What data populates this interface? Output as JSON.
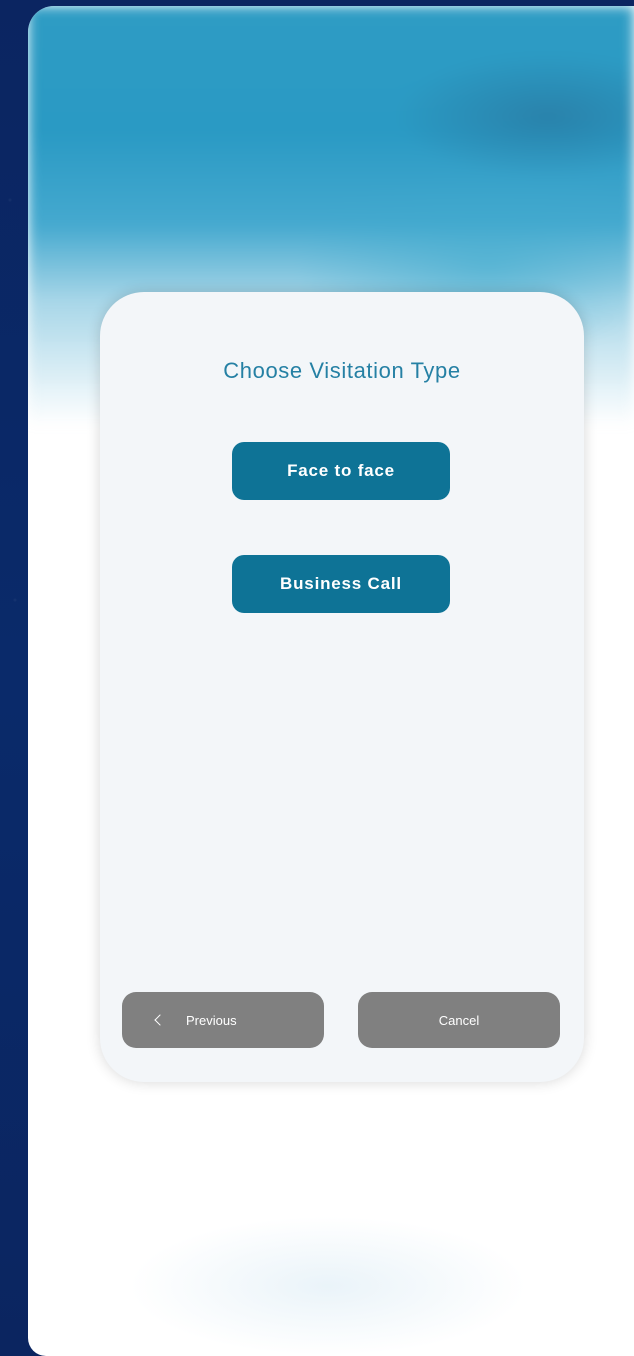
{
  "dialog": {
    "title": "Choose Visitation Type",
    "options": [
      {
        "label": "Face to face"
      },
      {
        "label": "Business Call"
      }
    ],
    "footer": {
      "previous_label": "Previous",
      "cancel_label": "Cancel"
    }
  },
  "colors": {
    "background": "#0b2460",
    "accent": "#0e7396",
    "title": "#2580a4",
    "neutral_button": "#808080",
    "card": "#f3f6f9"
  },
  "icons": {
    "previous": "chevron-left-icon"
  }
}
